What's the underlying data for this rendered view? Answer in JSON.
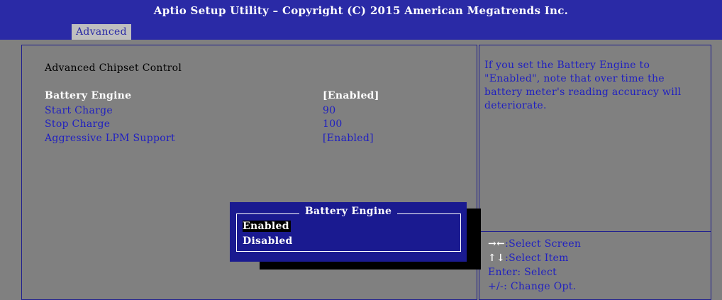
{
  "header": {
    "title": "Aptio Setup Utility – Copyright (C) 2015 American Megatrends Inc.",
    "tab": "Advanced"
  },
  "main": {
    "section_title": "Advanced Chipset Control",
    "rows": [
      {
        "label": "Battery Engine",
        "value": "[Enabled]"
      },
      {
        "label": "Start Charge",
        "value": "90"
      },
      {
        "label": "Stop Charge",
        "value": "100"
      },
      {
        "label": "Aggressive LPM Support",
        "value": "[Enabled]"
      }
    ]
  },
  "help": {
    "text": "If you set the Battery Engine to \"Enabled\", note that over time the battery meter's reading accuracy will deteriorate."
  },
  "keys": [
    {
      "key": "→←",
      "desc": ":Select Screen"
    },
    {
      "key": "↑↓",
      "desc": ":Select Item"
    },
    {
      "key": "",
      "desc": "Enter: Select"
    },
    {
      "key": "",
      "desc": "+/-: Change Opt."
    }
  ],
  "popup": {
    "title": "Battery Engine",
    "options": [
      "Enabled",
      "Disabled"
    ],
    "selected": "Enabled"
  },
  "colors": {
    "background": "#808080",
    "header": "#2a2aa6",
    "text_blue": "#2020c0",
    "popup": "#1a1a90"
  }
}
